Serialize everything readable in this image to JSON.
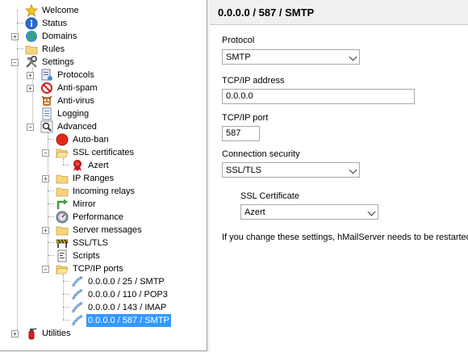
{
  "tree": {
    "welcome": "Welcome",
    "status": "Status",
    "domains": "Domains",
    "rules": "Rules",
    "settings": "Settings",
    "protocols": "Protocols",
    "antispam": "Anti-spam",
    "antivirus": "Anti-virus",
    "logging": "Logging",
    "advanced": "Advanced",
    "autoban": "Auto-ban",
    "ssl_certificates": "SSL certificates",
    "azert": "Azert",
    "ip_ranges": "IP Ranges",
    "incoming_relays": "Incoming relays",
    "mirror": "Mirror",
    "performance": "Performance",
    "server_messages": "Server messages",
    "ssl_tls": "SSL/TLS",
    "scripts": "Scripts",
    "tcpip_ports": "TCP/IP ports",
    "ports": [
      "0.0.0.0 / 25 / SMTP",
      "0.0.0.0 / 110 / POP3",
      "0.0.0.0 / 143 / IMAP",
      "0.0.0.0 / 587 / SMTP"
    ],
    "utilities": "Utilities"
  },
  "panel": {
    "title": "0.0.0.0 / 587 / SMTP",
    "protocol_label": "Protocol",
    "protocol_value": "SMTP",
    "address_label": "TCP/IP address",
    "address_value": "0.0.0.0",
    "port_label": "TCP/IP port",
    "port_value": "587",
    "security_label": "Connection security",
    "security_value": "SSL/TLS",
    "cert_label": "SSL Certificate",
    "cert_value": "Azert",
    "restart_note": "If you change these settings, hMailServer needs to be restarted fo"
  },
  "colors": {
    "selection": "#3399ff"
  }
}
